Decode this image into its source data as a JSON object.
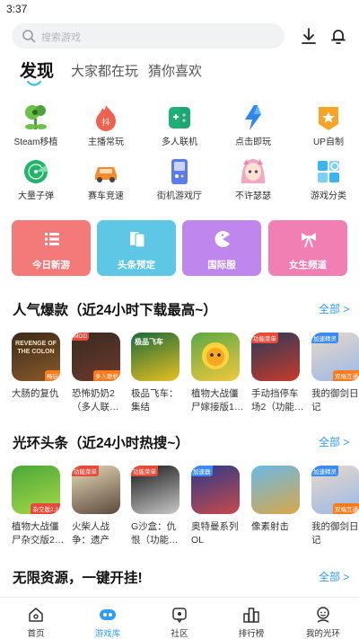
{
  "status_bar": {
    "time": "3:37"
  },
  "search": {
    "placeholder": "搜索游戏"
  },
  "tabs": [
    {
      "label": "发现",
      "active": true
    },
    {
      "label": "大家都在玩",
      "active": false
    },
    {
      "label": "猜你喜欢",
      "active": false
    }
  ],
  "categories": [
    {
      "label": "Steam移植",
      "icon": "plant-icon"
    },
    {
      "label": "主播常玩",
      "icon": "flame-icon"
    },
    {
      "label": "多人联机",
      "icon": "gamepad-icon"
    },
    {
      "label": "点击即玩",
      "icon": "lightning-icon"
    },
    {
      "label": "UP自制",
      "icon": "up-badge-icon"
    },
    {
      "label": "大量子弹",
      "icon": "radar-icon"
    },
    {
      "label": "赛车竞速",
      "icon": "car-icon"
    },
    {
      "label": "街机游戏厅",
      "icon": "arcade-icon"
    },
    {
      "label": "不许瑟瑟",
      "icon": "anime-girl-icon"
    },
    {
      "label": "游戏分类",
      "icon": "category-icon"
    }
  ],
  "feature_cards": [
    {
      "label": "今日新游",
      "color": "#f47a7a",
      "icon": "list-icon"
    },
    {
      "label": "头条预定",
      "color": "#5fc7e6",
      "icon": "cards-icon"
    },
    {
      "label": "国际服",
      "color": "#bf86ee",
      "icon": "pacman-icon"
    },
    {
      "label": "女生频道",
      "color": "#f27fb4",
      "icon": "bow-icon"
    }
  ],
  "sections": [
    {
      "title": "人气爆款（近24小时下载最高~）",
      "more": "全部 >",
      "games": [
        {
          "name": "大肠的复仇",
          "art_text": "REVENGE OF THE COLON",
          "badge": "畅玩",
          "colors": [
            "#3a2a1a",
            "#8a5a2a"
          ]
        },
        {
          "name": "恐怖奶奶2（多人联…",
          "art_text": "MOD",
          "badge": "多人联机",
          "colors": [
            "#3a2a22",
            "#6b3a2a"
          ]
        },
        {
          "name": "极品飞车：集结",
          "art_text": "极品飞车",
          "badge": "",
          "colors": [
            "#1a6a3a",
            "#e8c020"
          ]
        },
        {
          "name": "植物大战僵尸嫁接版1…",
          "art_text": "",
          "badge": "",
          "colors": [
            "#5aa848",
            "#f2c83a"
          ]
        },
        {
          "name": "手动挡停车场2（功能…",
          "art_text": "功能菜单",
          "badge": "功能菜单",
          "colors": [
            "#2a3a5a",
            "#c83a2a"
          ]
        },
        {
          "name": "我的御剑日记",
          "art_text": "加速精灵",
          "badge": "双端互通",
          "colors": [
            "#e8d8c8",
            "#9ab8e8"
          ]
        }
      ]
    },
    {
      "title": "光环头条（近24小时热搜~）",
      "more": "全部 >",
      "games": [
        {
          "name": "植物大战僵尸杂交版2…",
          "art_text": "杂交版2",
          "badge": "杂交版2.2",
          "colors": [
            "#4aa838",
            "#a8d848"
          ]
        },
        {
          "name": "火柴人战争：遗产（…",
          "art_text": "功能菜单",
          "badge": "功能菜单",
          "colors": [
            "#e8d8b8",
            "#5a4a3a"
          ]
        },
        {
          "name": "G沙盒：仇恨（功能…",
          "art_text": "功能菜单",
          "badge": "功能菜单",
          "colors": [
            "#1a1a1a",
            "#c8c8c8"
          ]
        },
        {
          "name": "奥特曼系列OL",
          "art_text": "加速器",
          "badge": "",
          "colors": [
            "#2a3a8a",
            "#c84a4a"
          ]
        },
        {
          "name": "像素射击",
          "art_text": "",
          "badge": "",
          "colors": [
            "#6ab8e8",
            "#d8a848"
          ]
        },
        {
          "name": "我的御剑日记",
          "art_text": "加速精灵",
          "badge": "双端互通",
          "colors": [
            "#e8d8c8",
            "#9ab8e8"
          ]
        }
      ]
    },
    {
      "title": "无限资源，一键开挂!",
      "more": "全部 >",
      "games": []
    }
  ],
  "bottom_nav": [
    {
      "label": "首页",
      "icon": "home-icon",
      "active": false
    },
    {
      "label": "游戏库",
      "icon": "game-library-icon",
      "active": true
    },
    {
      "label": "社区",
      "icon": "community-icon",
      "active": false
    },
    {
      "label": "排行榜",
      "icon": "ranking-icon",
      "active": false
    },
    {
      "label": "我的光环",
      "icon": "profile-icon",
      "active": false
    }
  ],
  "colors": {
    "accent": "#2e9df5",
    "active_tab_indicator": "#2ec3d8"
  }
}
